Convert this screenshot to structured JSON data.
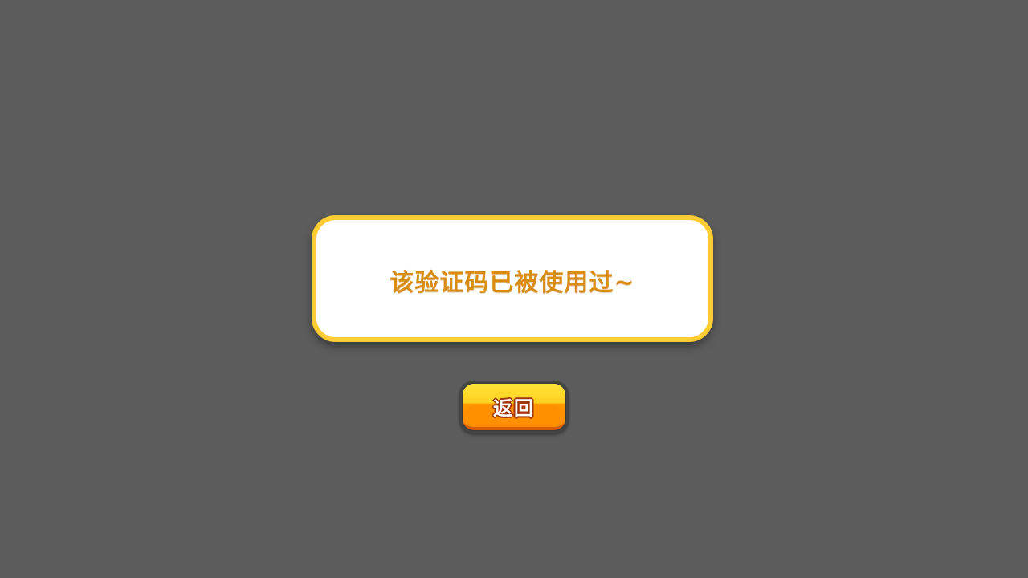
{
  "dialog": {
    "message": "该验证码已被使用过~"
  },
  "back_button": {
    "label": "返回"
  },
  "colors": {
    "background": "#5c5c5c",
    "dialog_border": "#ffcc33",
    "message_text": "#d98c12",
    "button_top": "#ffe23a",
    "button_bottom": "#ff8a00"
  }
}
